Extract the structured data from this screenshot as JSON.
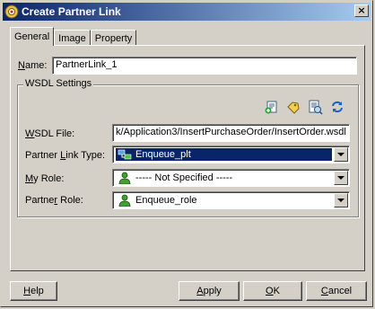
{
  "window": {
    "title": "Create Partner Link",
    "close_glyph": "×"
  },
  "tabs": [
    {
      "label": "General",
      "active": true
    },
    {
      "label": "Image",
      "active": false
    },
    {
      "label": "Property",
      "active": false
    }
  ],
  "name_field": {
    "label_mnemonic": "N",
    "label_rest": "ame:",
    "value": "PartnerLink_1"
  },
  "wsdl_group": {
    "title": "WSDL Settings",
    "toolbar_icons": [
      "add-wsdl-icon",
      "browse-wsdl-icon",
      "service-explorer-icon",
      "refresh-icon"
    ],
    "wsdl_file": {
      "label_mnemonic": "W",
      "label_rest": "SDL File:",
      "value": "k/Application3/InsertPurchaseOrder/InsertOrder.wsdl"
    },
    "partner_link_type": {
      "label_pre": "Partner ",
      "label_mnemonic": "L",
      "label_rest": "ink Type:",
      "value": "Enqueue_plt"
    },
    "my_role": {
      "label_mnemonic": "M",
      "label_rest": "y Role:",
      "value": "----- Not Specified -----"
    },
    "partner_role": {
      "label_pre": "Partne",
      "label_mnemonic": "r",
      "label_rest": " Role:",
      "value": "Enqueue_role"
    }
  },
  "buttons": {
    "help": {
      "mnemonic": "H",
      "rest": "elp"
    },
    "apply": {
      "pre": "",
      "mnemonic": "A",
      "rest": "pply"
    },
    "ok": {
      "mnemonic": "O",
      "rest": "K"
    },
    "cancel": {
      "pre": "",
      "mnemonic": "C",
      "rest": "ancel"
    }
  },
  "colors": {
    "titlebar_start": "#0a246a",
    "titlebar_end": "#a6caf0",
    "selection": "#0a246a",
    "face": "#d4d0c8"
  }
}
